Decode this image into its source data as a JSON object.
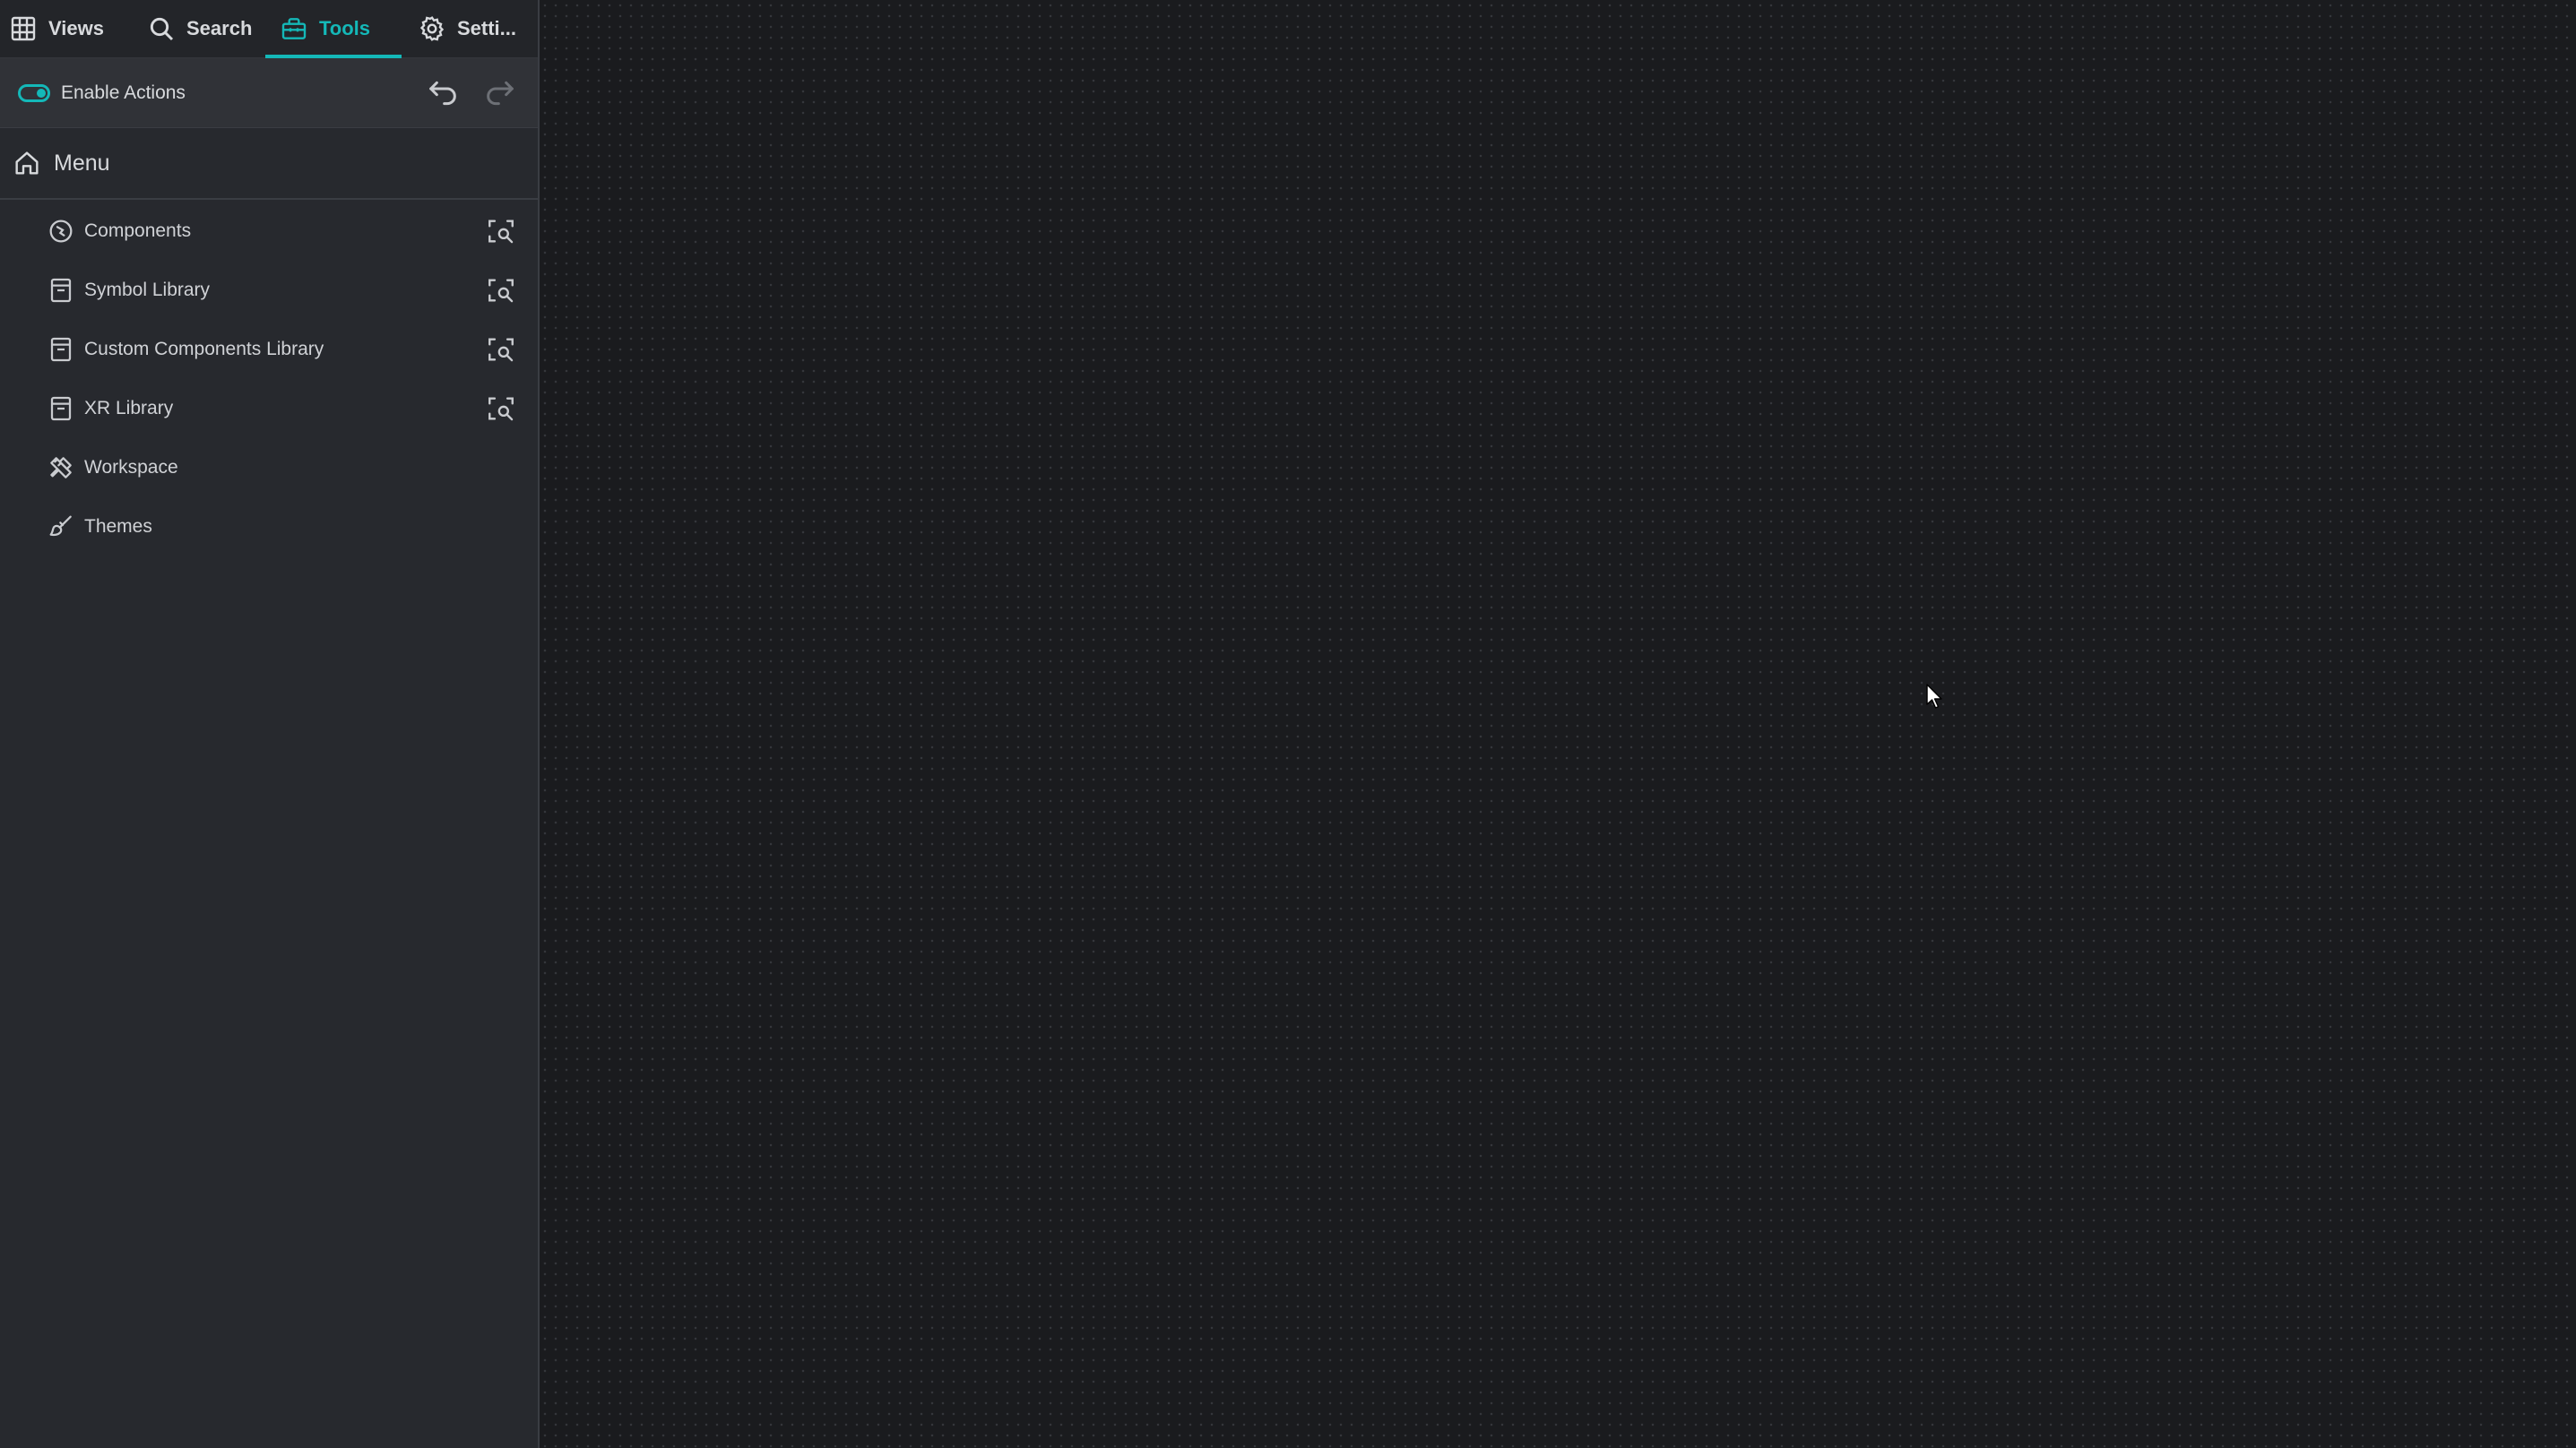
{
  "tabs": {
    "views": "Views",
    "search": "Search",
    "tools": "Tools",
    "settings": "Setti..."
  },
  "actions": {
    "enable_label": "Enable Actions",
    "enabled": true
  },
  "menu": {
    "title": "Menu",
    "items": [
      {
        "label": "Components",
        "icon": "components-icon",
        "has_action": true
      },
      {
        "label": "Symbol Library",
        "icon": "library-icon",
        "has_action": true
      },
      {
        "label": "Custom Components Library",
        "icon": "library-icon",
        "has_action": true
      },
      {
        "label": "XR Library",
        "icon": "library-icon",
        "has_action": true
      },
      {
        "label": "Workspace",
        "icon": "tools-cross-icon",
        "has_action": false
      },
      {
        "label": "Themes",
        "icon": "brush-icon",
        "has_action": false
      }
    ]
  },
  "colors": {
    "accent": "#14b8b8",
    "sidebar_bg": "#27292e",
    "canvas_bg": "#1a1b1e"
  }
}
